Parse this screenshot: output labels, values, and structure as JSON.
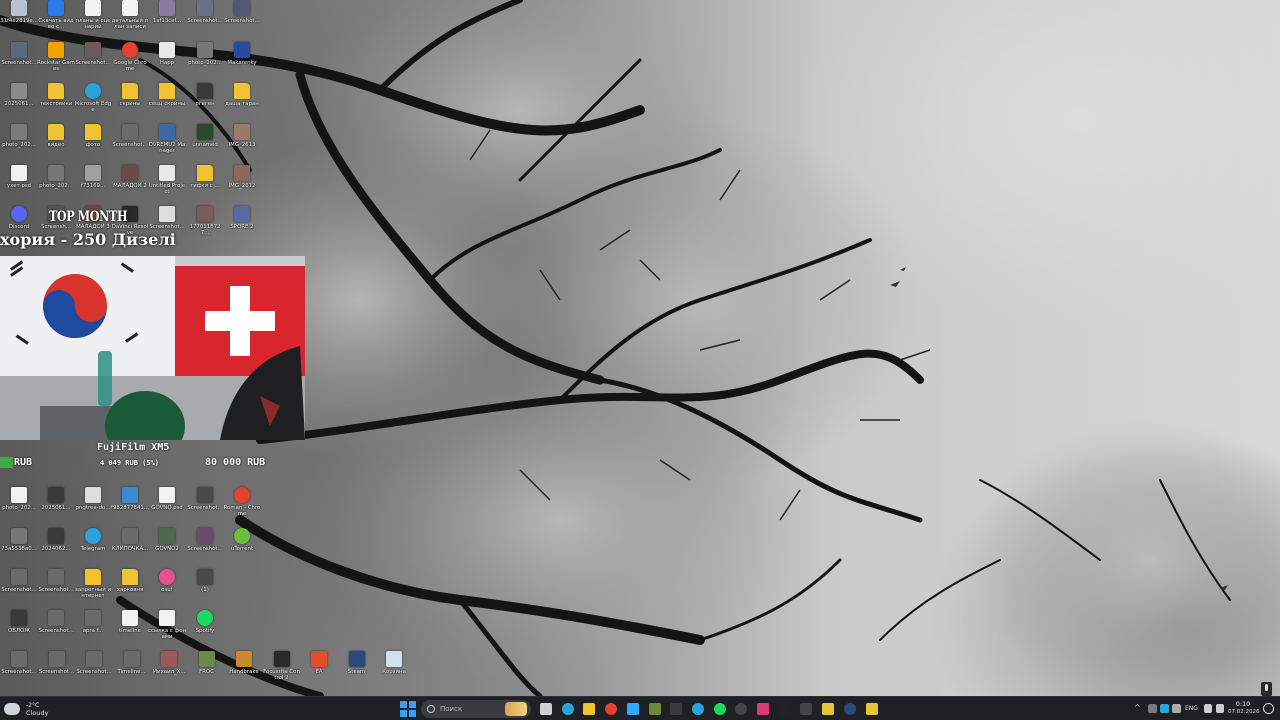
{
  "desktop": {
    "icons": [
      {
        "label": "31f4e2819e...",
        "icon": "file-icon",
        "color": "#b8c4d0"
      },
      {
        "label": "Скачать видео с...",
        "icon": "app-icon",
        "color": "#2e7be6"
      },
      {
        "label": "планы и сценарий",
        "icon": "document-icon",
        "color": "#f2f2f2"
      },
      {
        "label": "детальный план записи",
        "icon": "document-icon",
        "color": "#f2f2f2"
      },
      {
        "label": "1af13cef...",
        "icon": "image-icon",
        "color": "#8a7aa0"
      },
      {
        "label": "Screenshot...",
        "icon": "image-icon",
        "color": "#6f6f8a"
      },
      {
        "label": "Screenshot...",
        "icon": "image-icon",
        "color": "#555577"
      },
      {
        "label": "Screenshot...",
        "icon": "image-icon",
        "color": "#5a6a7a"
      },
      {
        "label": "Rockstar Games",
        "icon": "app-icon",
        "color": "#f4a300"
      },
      {
        "label": "Screenshot...",
        "icon": "image-icon",
        "color": "#6a5a5a"
      },
      {
        "label": "Google Chrome",
        "icon": "chrome-icon",
        "color": "#e5412f"
      },
      {
        "label": "Happ",
        "icon": "app-icon",
        "color": "#e8e8e8"
      },
      {
        "label": "photo_202...",
        "icon": "image-icon",
        "color": "#777"
      },
      {
        "label": "Makarenky",
        "icon": "image-icon",
        "color": "#2a4aa0"
      },
      {
        "label": "2025061...",
        "icon": "image-icon",
        "color": "#8a8a8a"
      },
      {
        "label": "текстовики",
        "icon": "folder-icon",
        "color": "#f1c232"
      },
      {
        "label": "Microsoft Edge",
        "icon": "edge-icon",
        "color": "#2aa3d8"
      },
      {
        "label": "скрины",
        "icon": "folder-icon",
        "color": "#f1c232"
      },
      {
        "label": "сёцц скрины",
        "icon": "folder-icon",
        "color": "#f1c232"
      },
      {
        "label": "ргеген",
        "icon": "folder-icon",
        "color": "#3a3a3a"
      },
      {
        "label": "даша таран",
        "icon": "folder-icon",
        "color": "#f1c232"
      },
      {
        "label": "photo_202...",
        "icon": "image-icon",
        "color": "#7a7a7a"
      },
      {
        "label": "видео",
        "icon": "folder-icon",
        "color": "#f1c232"
      },
      {
        "label": "фото",
        "icon": "folder-icon",
        "color": "#f1c232"
      },
      {
        "label": "Screenshot...",
        "icon": "image-icon",
        "color": "#6a6a6a"
      },
      {
        "label": "DVREMU2 Manager",
        "icon": "app-icon",
        "color": "#3a6aa0"
      },
      {
        "label": "unnamed",
        "icon": "image-icon",
        "color": "#2a4a2a"
      },
      {
        "label": "IMG_2613",
        "icon": "image-icon",
        "color": "#9a7a6a"
      },
      {
        "label": "ухет.psd",
        "icon": "document-icon",
        "color": "#f2f2f2"
      },
      {
        "label": "photo_202...",
        "icon": "image-icon",
        "color": "#777"
      },
      {
        "label": "f73169...",
        "icon": "image-icon",
        "color": "#a0a0a0"
      },
      {
        "label": "МАЛАДОЙ 2",
        "icon": "image-icon",
        "color": "#6a4a4a"
      },
      {
        "label": "Untitled Project",
        "icon": "document-icon",
        "color": "#e8e8e8"
      },
      {
        "label": "гифки с ...",
        "icon": "folder-icon",
        "color": "#f1c232"
      },
      {
        "label": "IMG_2612",
        "icon": "image-icon",
        "color": "#8a6a5a"
      },
      {
        "label": "Discord",
        "icon": "discord-icon",
        "color": "#5865f2"
      },
      {
        "label": "Screensh...",
        "icon": "image-icon",
        "color": "#555"
      },
      {
        "label": "МАЛАДОЙ 3",
        "icon": "image-icon",
        "color": "#6a4a4a"
      },
      {
        "label": "DaVinci Resolve",
        "icon": "app-icon",
        "color": "#2a2a2a"
      },
      {
        "label": "Screenshot...",
        "icon": "image-icon",
        "color": "#ddd"
      },
      {
        "label": "1770118727...",
        "icon": "image-icon",
        "color": "#7a5a5a"
      },
      {
        "label": "SPORE 2",
        "icon": "image-icon",
        "color": "#5a6aa0"
      },
      {
        "label": "photo_202...",
        "icon": "document-icon",
        "color": "#f2f2f2"
      },
      {
        "label": "2025061...",
        "icon": "image-icon",
        "color": "#3a3a3a"
      },
      {
        "label": "pngtree-do...",
        "icon": "image-icon",
        "color": "#ddd"
      },
      {
        "label": "f982877841...",
        "icon": "image-icon",
        "color": "#3a8ad0"
      },
      {
        "label": "GOVNO.psd",
        "icon": "document-icon",
        "color": "#f2f2f2"
      },
      {
        "label": "Screenshot...",
        "icon": "image-icon",
        "color": "#4a4a4a"
      },
      {
        "label": "Roman - Chrome",
        "icon": "chrome-icon",
        "color": "#e5412f"
      },
      {
        "label": "73a5538a0...",
        "icon": "image-icon",
        "color": "#777"
      },
      {
        "label": "2024062...",
        "icon": "image-icon",
        "color": "#3a3a3a"
      },
      {
        "label": "Telegram",
        "icon": "telegram-icon",
        "color": "#2aa3e0"
      },
      {
        "label": "КЛИПОЧКА...",
        "icon": "image-icon",
        "color": "#6a6a6a"
      },
      {
        "label": "GOVNO2",
        "icon": "image-icon",
        "color": "#4a6a4a"
      },
      {
        "label": "Screenshot...",
        "icon": "image-icon",
        "color": "#6a4a6a"
      },
      {
        "label": "uTorrent",
        "icon": "utorrent-icon",
        "color": "#6cbf3a"
      },
      {
        "label": "Screenshot...",
        "icon": "image-icon",
        "color": "#6a6a6a"
      },
      {
        "label": "Screenshot...",
        "icon": "image-icon",
        "color": "#6a6a6a"
      },
      {
        "label": "запретный интернет",
        "icon": "folder-icon",
        "color": "#f1c232"
      },
      {
        "label": "харковня",
        "icon": "folder-icon",
        "color": "#f1c232"
      },
      {
        "label": "osu!",
        "icon": "osu-icon",
        "color": "#e5508e"
      },
      {
        "label": "(1)",
        "icon": "image-icon",
        "color": "#4a4a4a"
      },
      {
        "label": "ОБЛОЖ",
        "icon": "image-icon",
        "color": "#3a3a3a"
      },
      {
        "label": "Screenshot...",
        "icon": "image-icon",
        "color": "#6a6a6a"
      },
      {
        "label": "apra f...",
        "icon": "image-icon",
        "color": "#6a6a6a"
      },
      {
        "label": "timeline",
        "icon": "document-icon",
        "color": "#f2f2f2"
      },
      {
        "label": "ссылка с фонами",
        "icon": "document-icon",
        "color": "#f2f2f2"
      },
      {
        "label": "Spotify",
        "icon": "spotify-icon",
        "color": "#1ed760"
      },
      {
        "label": "Screenshot...",
        "icon": "image-icon",
        "color": "#6a6a6a"
      },
      {
        "label": "Screenshot...",
        "icon": "image-icon",
        "color": "#6a6a6a"
      },
      {
        "label": "Screenshot...",
        "icon": "image-icon",
        "color": "#6a6a6a"
      },
      {
        "label": "Timeline...",
        "icon": "image-icon",
        "color": "#6a6a6a"
      },
      {
        "label": "Михаил_X...",
        "icon": "image-icon",
        "color": "#9a5a5a"
      },
      {
        "label": "FROC",
        "icon": "image-icon",
        "color": "#6a8a4a"
      },
      {
        "label": "Handbrake",
        "icon": "app-icon",
        "color": "#c9892a"
      },
      {
        "label": "Focusrite Control 2",
        "icon": "app-icon",
        "color": "#2a2a2a"
      },
      {
        "label": "EA",
        "icon": "app-icon",
        "color": "#e84a2a"
      },
      {
        "label": "Steam",
        "icon": "steam-icon",
        "color": "#2a4a7a"
      },
      {
        "label": "Корзина",
        "icon": "recycle-bin-icon",
        "color": "#cfe0ef"
      }
    ]
  },
  "overlay": {
    "top_month_title": "TOP MONTH",
    "top_month_entry": "хория - 250  Дизелі",
    "goal_title": "FujiFilm XM5",
    "goal_current": "RUB",
    "goal_progress_text": "4 049 RUB (5%)",
    "goal_target": "80 000 RUB",
    "goal_progress": 0.05,
    "goal_color": "#3fa94a"
  },
  "taskbar": {
    "weather_temp": "-2°C",
    "weather_cond": "Cloudy",
    "search_placeholder": "Поиск",
    "apps": [
      {
        "name": "task-view",
        "color": "#cfcfcf"
      },
      {
        "name": "edge",
        "color": "#2aa3d8"
      },
      {
        "name": "file-explorer",
        "color": "#f1c232"
      },
      {
        "name": "chrome",
        "color": "#e5412f"
      },
      {
        "name": "photoshop",
        "color": "#31a8ff"
      },
      {
        "name": "minecraft",
        "color": "#6a8a3a"
      },
      {
        "name": "app-dark",
        "color": "#3a3a3a"
      },
      {
        "name": "telegram",
        "color": "#2aa3e0"
      },
      {
        "name": "spotify",
        "color": "#1ed760"
      },
      {
        "name": "obs",
        "color": "#444"
      },
      {
        "name": "app-pink",
        "color": "#d83a7a"
      },
      {
        "name": "app-h",
        "color": "#222"
      },
      {
        "name": "terminal",
        "color": "#444"
      },
      {
        "name": "app-yellow",
        "color": "#e8c43a"
      },
      {
        "name": "steam",
        "color": "#2a4a7a"
      },
      {
        "name": "app-notes",
        "color": "#e8c43a"
      }
    ],
    "lang": "ENG",
    "time": "0:10",
    "date": "07.02.2026"
  }
}
